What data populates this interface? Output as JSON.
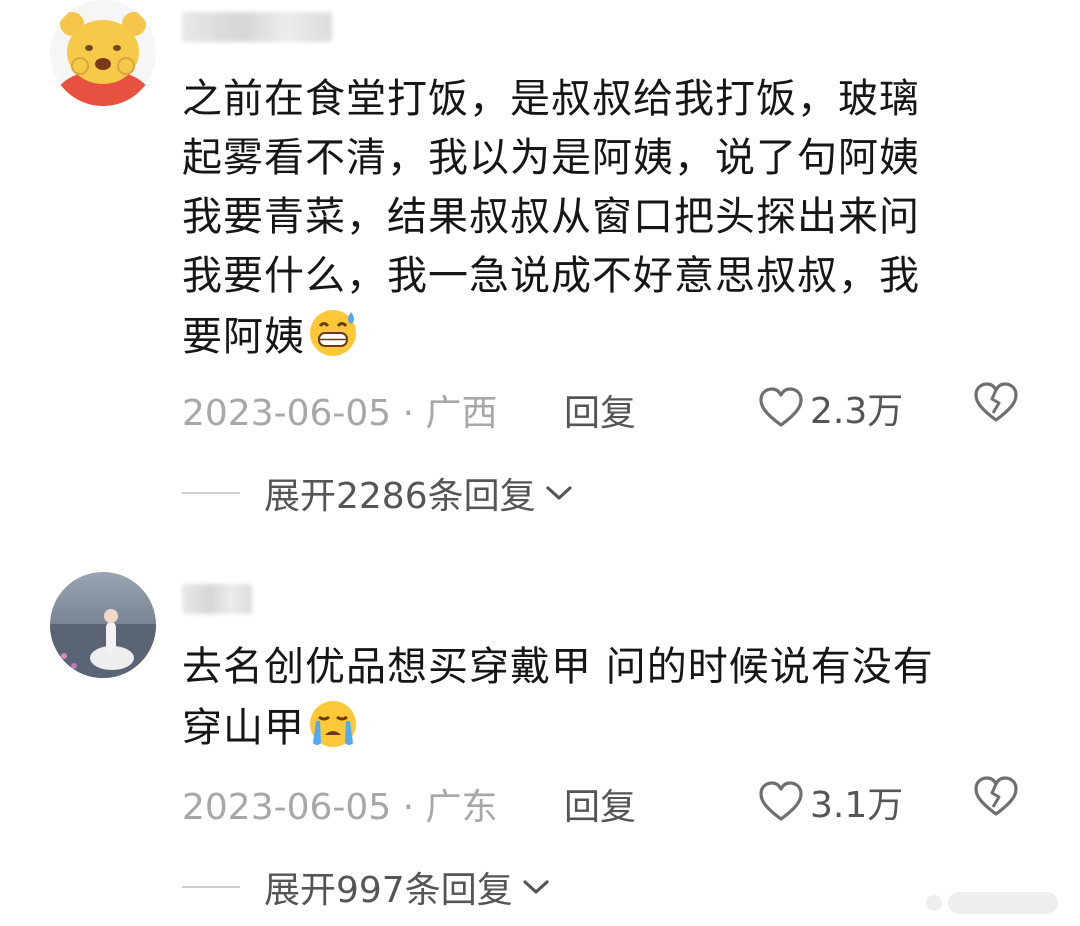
{
  "comments": [
    {
      "username": "NG",
      "avatar_icon": "cartoon-bear-avatar",
      "text": "之前在食堂打饭，是叔叔给我打饭，玻璃\n起雾看不清，我以为是阿姨，说了句阿姨\n我要青菜，结果叔叔从窗口把头探出来问\n我要什么，我一急说成不好意思叔叔，我\n要阿姨",
      "emoji": "grinning-sweat-emoji",
      "date_location": "2023-06-05 · 广西",
      "reply_label": "回复",
      "like_count": "2.3万",
      "expand_label": "展开2286条回复"
    },
    {
      "username": "7",
      "avatar_icon": "seaside-photo-avatar",
      "text": "去名创优品想买穿戴甲 问的时候说有没有\n穿山甲",
      "emoji": "crying-emoji",
      "date_location": "2023-06-05 · 广东",
      "reply_label": "回复",
      "like_count": "3.1万",
      "expand_label": "展开997条回复"
    }
  ]
}
